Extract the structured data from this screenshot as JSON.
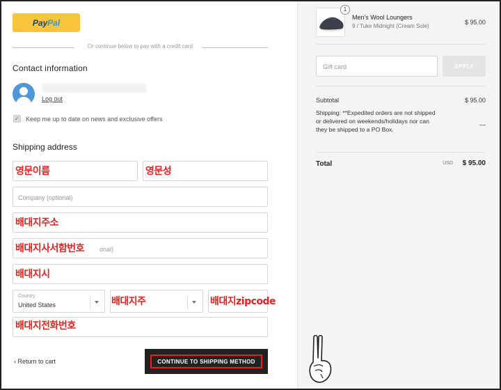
{
  "paypal": {
    "label_part1": "Pay",
    "label_part2": "Pal"
  },
  "divider_text": "Or continue below to pay with a credit card",
  "contact": {
    "heading": "Contact information",
    "logout": "Log out",
    "newsletter_checked": true,
    "newsletter_label": "Keep me up to date on news and exclusive offers"
  },
  "shipping": {
    "heading": "Shipping address",
    "company_placeholder": "Company (optional)",
    "apt_placeholder_tail": "onal)",
    "country_label": "Country",
    "country_value": "United States"
  },
  "annotations": {
    "first_name": "영문이름",
    "last_name": "영문성",
    "address": "배대지주소",
    "apt": "배대지사서함번호",
    "city": "배대지시",
    "state": "배대지주",
    "zip": "배대지zipcode",
    "phone": "배대지전화번호"
  },
  "footer": {
    "return_link": "‹ Return to cart",
    "continue_button": "CONTINUE TO SHIPPING METHOD"
  },
  "order": {
    "item_quantity": "1",
    "item_name": "Men's Wool Loungers",
    "item_variant": "9 / Tuke Midnight (Cream Sole)",
    "item_price": "$ 95.00",
    "gift_placeholder": "Gift card",
    "apply_label": "APPLY",
    "subtotal_label": "Subtotal",
    "subtotal_value": "$ 95.00",
    "shipping_note": "Shipping: **Expedited orders are not shipped or delivered on weekends/holidays nor can they be shipped to a PO Box.",
    "shipping_value": "—",
    "total_label": "Total",
    "total_currency": "USD",
    "total_value": "$ 95.00"
  },
  "colors": {
    "paypal_yellow": "#f8c43b",
    "annotation_red": "#e32222",
    "button_dark": "#222222",
    "sidebar_bg": "#f4f4f4"
  }
}
